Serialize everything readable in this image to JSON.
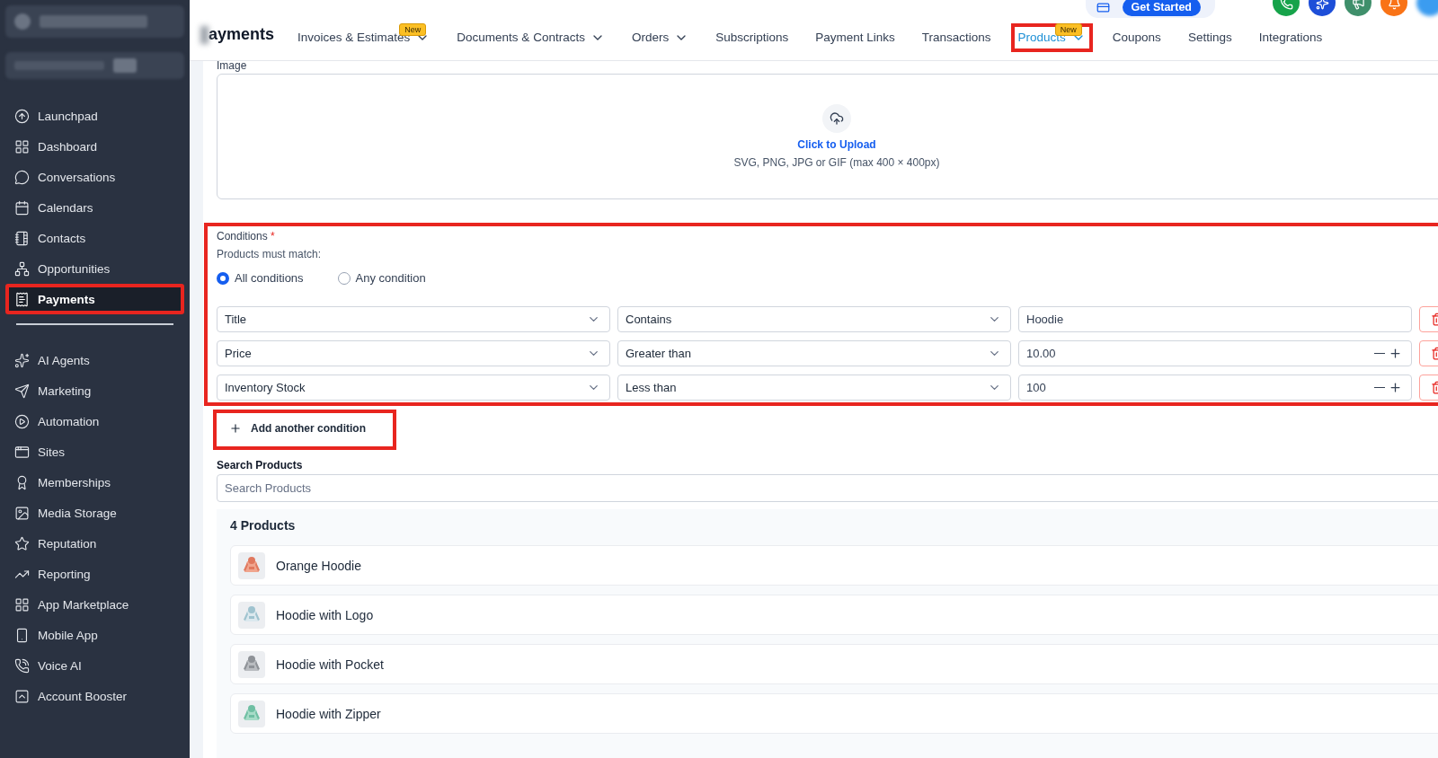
{
  "sidebar": {
    "groups": [
      {
        "items": [
          {
            "label": "Launchpad",
            "selected": false,
            "highlighted": false
          },
          {
            "label": "Dashboard",
            "selected": false,
            "highlighted": false
          },
          {
            "label": "Conversations",
            "selected": false,
            "highlighted": false
          },
          {
            "label": "Calendars",
            "selected": false,
            "highlighted": false
          },
          {
            "label": "Contacts",
            "selected": false,
            "highlighted": false
          },
          {
            "label": "Opportunities",
            "selected": false,
            "highlighted": false
          },
          {
            "label": "Payments",
            "selected": true,
            "highlighted": true
          }
        ]
      },
      {
        "items": [
          {
            "label": "AI Agents",
            "selected": false,
            "highlighted": false
          },
          {
            "label": "Marketing",
            "selected": false,
            "highlighted": false
          },
          {
            "label": "Automation",
            "selected": false,
            "highlighted": false
          },
          {
            "label": "Sites",
            "selected": false,
            "highlighted": false
          },
          {
            "label": "Memberships",
            "selected": false,
            "highlighted": false
          },
          {
            "label": "Media Storage",
            "selected": false,
            "highlighted": false
          },
          {
            "label": "Reputation",
            "selected": false,
            "highlighted": false
          },
          {
            "label": "Reporting",
            "selected": false,
            "highlighted": false
          },
          {
            "label": "App Marketplace",
            "selected": false,
            "highlighted": false
          },
          {
            "label": "Mobile App",
            "selected": false,
            "highlighted": false
          },
          {
            "label": "Voice AI",
            "selected": false,
            "highlighted": false
          },
          {
            "label": "Account Booster",
            "selected": false,
            "highlighted": false
          }
        ]
      }
    ]
  },
  "header": {
    "title": "ayments",
    "get_started": "Get Started",
    "tabs": [
      {
        "label": "Invoices & Estimates",
        "selected": false,
        "dropdown": true,
        "badge": "New",
        "highlighted": false
      },
      {
        "label": "Documents & Contracts",
        "selected": false,
        "dropdown": true,
        "highlighted": false
      },
      {
        "label": "Orders",
        "selected": false,
        "dropdown": true,
        "highlighted": false
      },
      {
        "label": "Subscriptions",
        "selected": false,
        "dropdown": false,
        "highlighted": false
      },
      {
        "label": "Payment Links",
        "selected": false,
        "dropdown": false,
        "highlighted": false
      },
      {
        "label": "Transactions",
        "selected": false,
        "dropdown": false,
        "highlighted": false
      },
      {
        "label": "Products",
        "selected": true,
        "dropdown": true,
        "badge": "New",
        "highlighted": true
      },
      {
        "label": "Coupons",
        "selected": false,
        "dropdown": false,
        "highlighted": false
      },
      {
        "label": "Settings",
        "selected": false,
        "dropdown": false,
        "highlighted": false
      },
      {
        "label": "Integrations",
        "selected": false,
        "dropdown": false,
        "highlighted": false
      }
    ]
  },
  "image_upload": {
    "label": "Image",
    "link": "Click to Upload",
    "hint": "SVG, PNG, JPG or GIF (max 400 × 400px)"
  },
  "conditions": {
    "label": "Conditions",
    "required_mark": "*",
    "highlighted": true,
    "subtitle": "Products must match:",
    "options": [
      {
        "label": "All conditions",
        "selected": true
      },
      {
        "label": "Any condition",
        "selected": false
      }
    ],
    "rows": [
      {
        "field": "Title",
        "operator": "Contains",
        "value": "Hoodie",
        "kind": "text"
      },
      {
        "field": "Price",
        "operator": "Greater than",
        "value": "10.00",
        "kind": "number"
      },
      {
        "field": "Inventory Stock",
        "operator": "Less than",
        "value": "100",
        "kind": "number"
      }
    ],
    "add_button": {
      "label": "Add another condition",
      "highlighted": true
    }
  },
  "search": {
    "label": "Search Products",
    "placeholder": "Search Products"
  },
  "products": {
    "count": "4 Products",
    "items": [
      {
        "name": "Orange Hoodie"
      },
      {
        "name": "Hoodie with Logo"
      },
      {
        "name": "Hoodie with Pocket"
      },
      {
        "name": "Hoodie with Zipper"
      }
    ]
  }
}
